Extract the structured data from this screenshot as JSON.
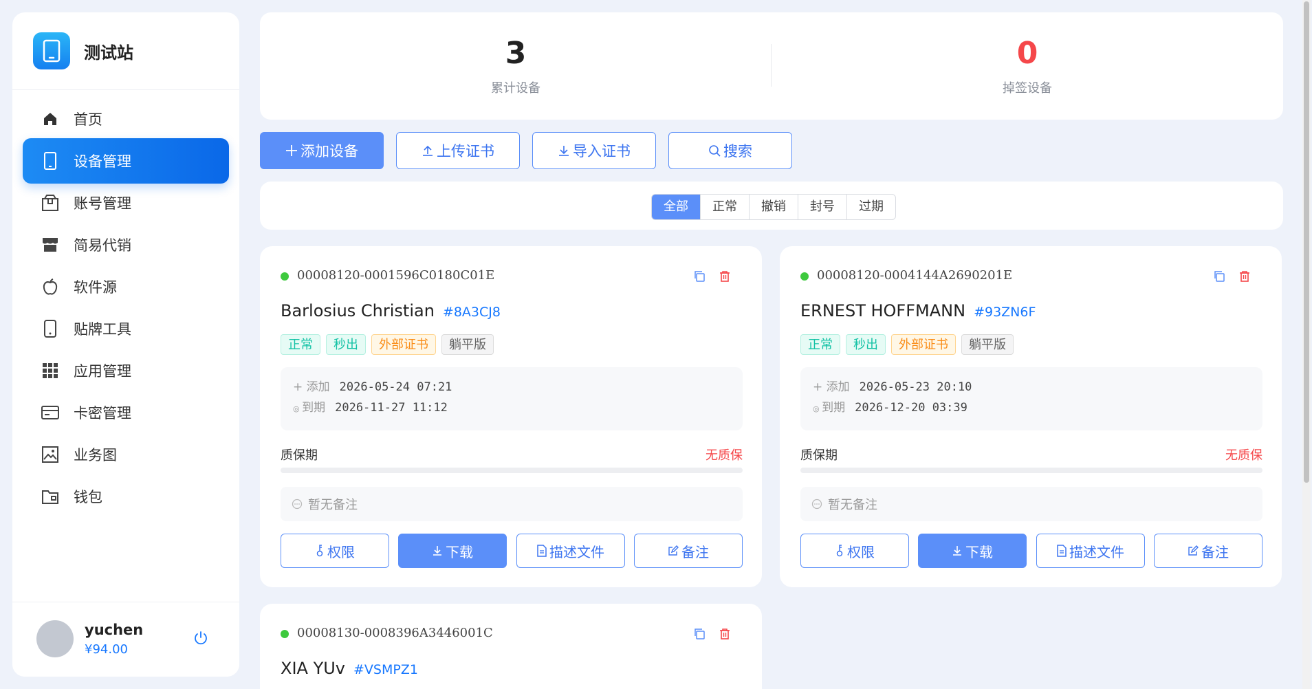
{
  "brand": {
    "name": "测试站",
    "icon": "tablet-icon"
  },
  "nav": [
    {
      "label": "首页",
      "icon": "home-icon",
      "active": false
    },
    {
      "label": "设备管理",
      "icon": "tablet-icon",
      "active": true
    },
    {
      "label": "账号管理",
      "icon": "package-icon",
      "active": false
    },
    {
      "label": "简易代销",
      "icon": "store-icon",
      "active": false
    },
    {
      "label": "软件源",
      "icon": "apple-icon",
      "active": false
    },
    {
      "label": "贴牌工具",
      "icon": "phone-icon",
      "active": false
    },
    {
      "label": "应用管理",
      "icon": "grid-icon",
      "active": false
    },
    {
      "label": "卡密管理",
      "icon": "card-icon",
      "active": false
    },
    {
      "label": "业务图",
      "icon": "image-icon",
      "active": false
    },
    {
      "label": "钱包",
      "icon": "wallet-icon",
      "active": false
    }
  ],
  "user": {
    "name": "yuchen",
    "balance": "¥94.00"
  },
  "stats": {
    "total": {
      "value": "3",
      "label": "累计设备",
      "color": "#222222"
    },
    "dropped": {
      "value": "0",
      "label": "掉签设备",
      "color": "#f5474a"
    }
  },
  "toolbar": {
    "add": "添加设备",
    "upload": "上传证书",
    "import": "导入证书",
    "search": "搜索"
  },
  "filters": [
    {
      "label": "全部",
      "active": true
    },
    {
      "label": "正常",
      "active": false
    },
    {
      "label": "撤销",
      "active": false
    },
    {
      "label": "封号",
      "active": false
    },
    {
      "label": "过期",
      "active": false
    }
  ],
  "labels": {
    "added": "添加",
    "expires": "到期",
    "warranty": "质保期",
    "perm": "权限",
    "download": "下载",
    "profile": "描述文件",
    "remark": "备注"
  },
  "devices": [
    {
      "udid": "00008120-0001596C0180C01E",
      "name": "Barlosius Christian",
      "code": "#8A3CJ8",
      "tags": [
        "正常",
        "秒出",
        "外部证书",
        "躺平版"
      ],
      "added": "2026-05-24 07:21",
      "expires": "2026-11-27 11:12",
      "warranty_status": "无质保",
      "warranty_progress": 0,
      "note": "暂无备注"
    },
    {
      "udid": "00008120-0004144A2690201E",
      "name": "ERNEST HOFFMANN",
      "code": "#93ZN6F",
      "tags": [
        "正常",
        "秒出",
        "外部证书",
        "躺平版"
      ],
      "added": "2026-05-23 20:10",
      "expires": "2026-12-20 03:39",
      "warranty_status": "无质保",
      "warranty_progress": 0,
      "note": "暂无备注"
    },
    {
      "udid": "00008130-0008396A3446001C",
      "name": "XIA YUv",
      "code": "#VSMPZ1"
    }
  ]
}
